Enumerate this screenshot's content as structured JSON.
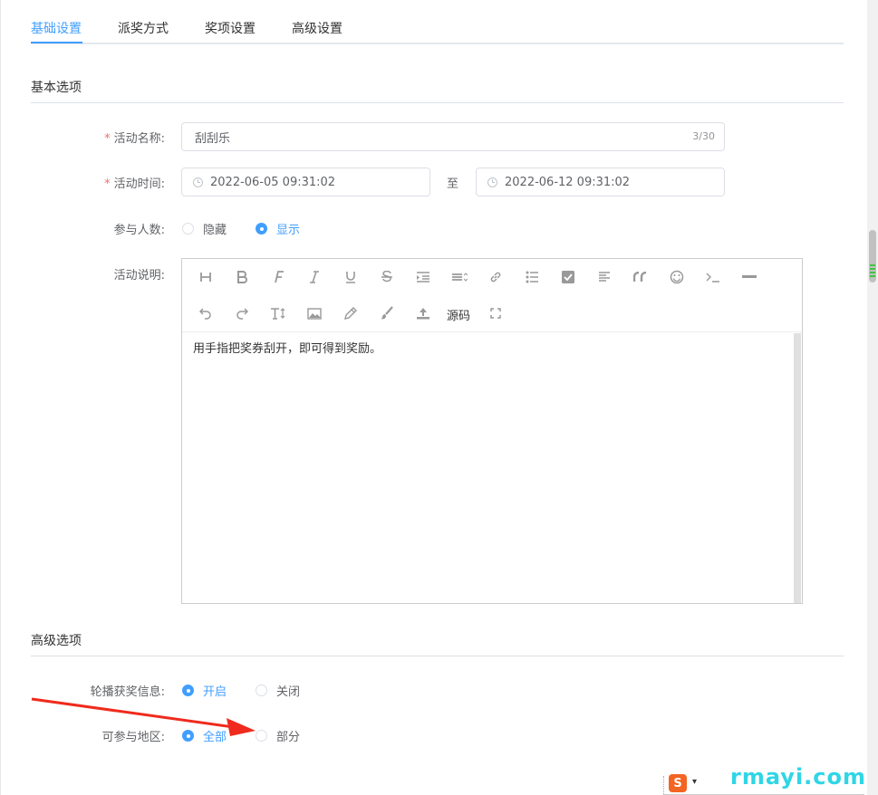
{
  "tabs": [
    {
      "label": "基础设置",
      "active": true
    },
    {
      "label": "派奖方式",
      "active": false
    },
    {
      "label": "奖项设置",
      "active": false
    },
    {
      "label": "高级设置",
      "active": false
    }
  ],
  "basic": {
    "section_title": "基本选项",
    "name": {
      "required_mark": "*",
      "label": "活动名称:",
      "value": "刮刮乐",
      "counter": "3/30"
    },
    "time": {
      "required_mark": "*",
      "label": "活动时间:",
      "start": "2022-06-05 09:31:02",
      "separator": "至",
      "end": "2022-06-12 09:31:02"
    },
    "participants": {
      "label": "参与人数:",
      "options": [
        {
          "label": "隐藏",
          "checked": false
        },
        {
          "label": "显示",
          "checked": true
        }
      ]
    },
    "description": {
      "label": "活动说明:",
      "toolbar_row1": [
        "heading-icon",
        "bold-icon",
        "font-icon",
        "italic-icon",
        "underline-icon",
        "strikethrough-icon",
        "indent-icon",
        "line-height-icon",
        "link-icon",
        "list-icon",
        "todo-icon",
        "justify-icon",
        "quote-icon",
        "emoticon-icon",
        "code-icon",
        "divider-icon"
      ],
      "toolbar_row2": [
        "undo-icon",
        "redo-icon",
        "font-size-icon",
        "image-icon",
        "pen-icon",
        "brush-icon",
        "upload-icon"
      ],
      "source_label": "源码",
      "toolbar_fullscreen": "fullscreen-icon",
      "content": "用手指把奖券刮开，即可得到奖励。"
    }
  },
  "advanced": {
    "section_title": "高级选项",
    "carousel": {
      "label": "轮播获奖信息:",
      "options": [
        {
          "label": "开启",
          "checked": true
        },
        {
          "label": "关闭",
          "checked": false
        }
      ]
    },
    "region": {
      "label": "可参与地区:",
      "options": [
        {
          "label": "全部",
          "checked": true
        },
        {
          "label": "部分",
          "checked": false
        }
      ]
    }
  },
  "overlay": {
    "watermark": "rmayi.com",
    "ime_logo": "S",
    "arrow_color": "#f02a1c"
  },
  "colors": {
    "accent": "#409eff",
    "required": "#f56c6c"
  }
}
